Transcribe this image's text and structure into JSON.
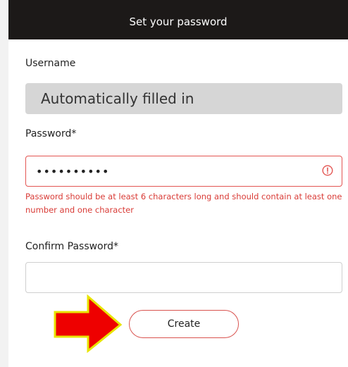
{
  "header": {
    "title": "Set your password"
  },
  "form": {
    "username_label": "Username",
    "username_value": "Automatically filled in",
    "password_label": "Password*",
    "password_value": "••••••••••",
    "password_error": "Password should be at least 6 characters long and should contain at least one number and one character",
    "confirm_label": "Confirm Password*",
    "confirm_value": "",
    "submit_label": "Create"
  },
  "icons": {
    "error": "exclamation-circle-icon",
    "annotation": "red-arrow-annotation"
  },
  "colors": {
    "header_bg": "#1c1918",
    "error": "#e35552",
    "button_border": "#d9534f",
    "arrow_fill": "#ee0000",
    "arrow_stroke": "#e8e400",
    "username_bg": "#d6d6d6"
  }
}
